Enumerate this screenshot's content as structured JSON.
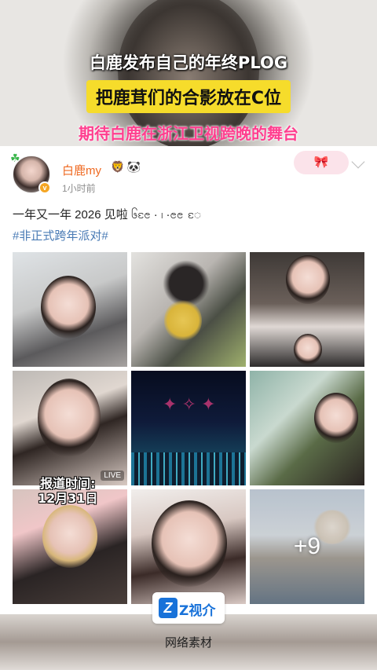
{
  "headlines": {
    "line1": "白鹿发布自己的年终PLOG",
    "line2": "把鹿茸们的合影放在C位",
    "line3": "期待白鹿在浙江卫视跨晚的舞台"
  },
  "post": {
    "username": "白鹿my",
    "badge_icons": [
      "crown-lion-icon",
      "panda-icon"
    ],
    "time": "1小时前",
    "text": "一年又一年 2026 见啦 ၆ၔႄ · ၊ ·ၔၔ ႄ",
    "hashtag": "#非正式跨年派对#",
    "sticker": "🎀"
  },
  "gallery": {
    "live_label": "LIVE",
    "more_count": "+9",
    "report_line1": "报道时间:",
    "report_line2": "12月31日"
  },
  "footer": {
    "logo_mark": "Z",
    "logo_name": "Z视介",
    "source": "网络素材"
  },
  "colors": {
    "headline_highlight": "#f6dc2b",
    "headline_pink": "#ff3f8f",
    "username": "#ef6a22",
    "hashtag": "#4a7bb5",
    "logo_blue": "#1872d9"
  }
}
